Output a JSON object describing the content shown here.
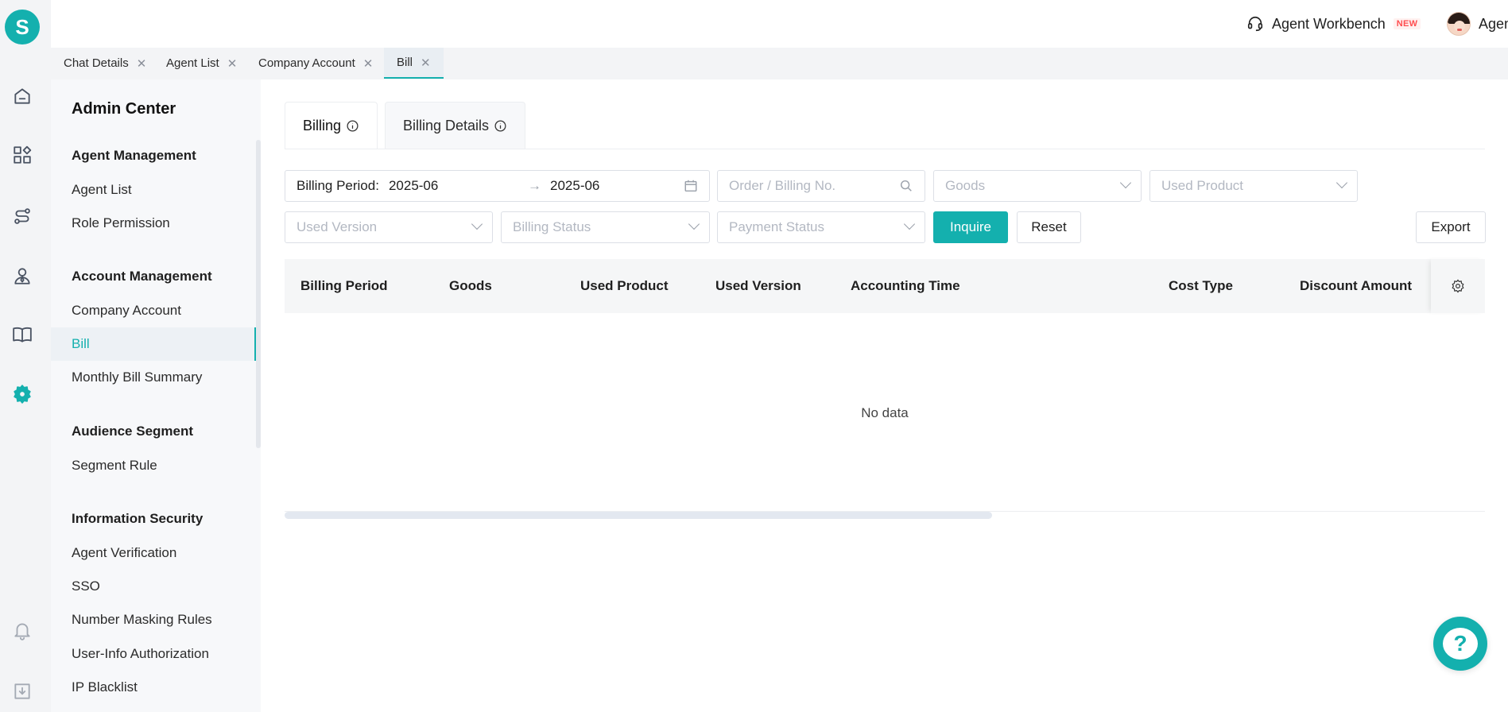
{
  "app": {
    "logo_letter": "S"
  },
  "header": {
    "workbench_label": "Agent Workbench",
    "new_badge": "NEW",
    "user_name": "Agent"
  },
  "page_tabs": [
    {
      "label": "Chat Details",
      "close": "✕"
    },
    {
      "label": "Agent List",
      "close": "✕"
    },
    {
      "label": "Company Account",
      "close": "✕"
    },
    {
      "label": "Bill",
      "close": "✕"
    }
  ],
  "subnav": {
    "title": "Admin Center",
    "groups": [
      {
        "heading": "Agent Management",
        "items": [
          "Agent List",
          "Role Permission"
        ]
      },
      {
        "heading": "Account Management",
        "items": [
          "Company Account",
          "Bill",
          "Monthly Bill Summary"
        ]
      },
      {
        "heading": "Audience Segment",
        "items": [
          "Segment Rule"
        ]
      },
      {
        "heading": "Information Security",
        "items": [
          "Agent Verification",
          "SSO",
          "Number Masking Rules",
          "User-Info Authorization",
          "IP Blacklist"
        ]
      }
    ],
    "active_item": "Bill"
  },
  "content_tabs": [
    "Billing",
    "Billing Details"
  ],
  "filters": {
    "billing_period_label": "Billing Period:",
    "period_start": "2025-06",
    "period_arrow": "→",
    "period_end": "2025-06",
    "order_placeholder": "Order / Billing No.",
    "goods_placeholder": "Goods",
    "used_product_placeholder": "Used Product",
    "used_version_placeholder": "Used Version",
    "billing_status_placeholder": "Billing Status",
    "payment_status_placeholder": "Payment Status"
  },
  "buttons": {
    "inquire": "Inquire",
    "reset": "Reset",
    "export": "Export"
  },
  "table": {
    "columns": [
      "Billing Period",
      "Goods",
      "Used Product",
      "Used Version",
      "Accounting Time",
      "Cost Type",
      "Discount Amount"
    ],
    "empty_text": "No data"
  },
  "help": {
    "symbol": "?"
  },
  "colors": {
    "accent": "#14b0ae",
    "rail_bg": "#f3f4f6"
  }
}
